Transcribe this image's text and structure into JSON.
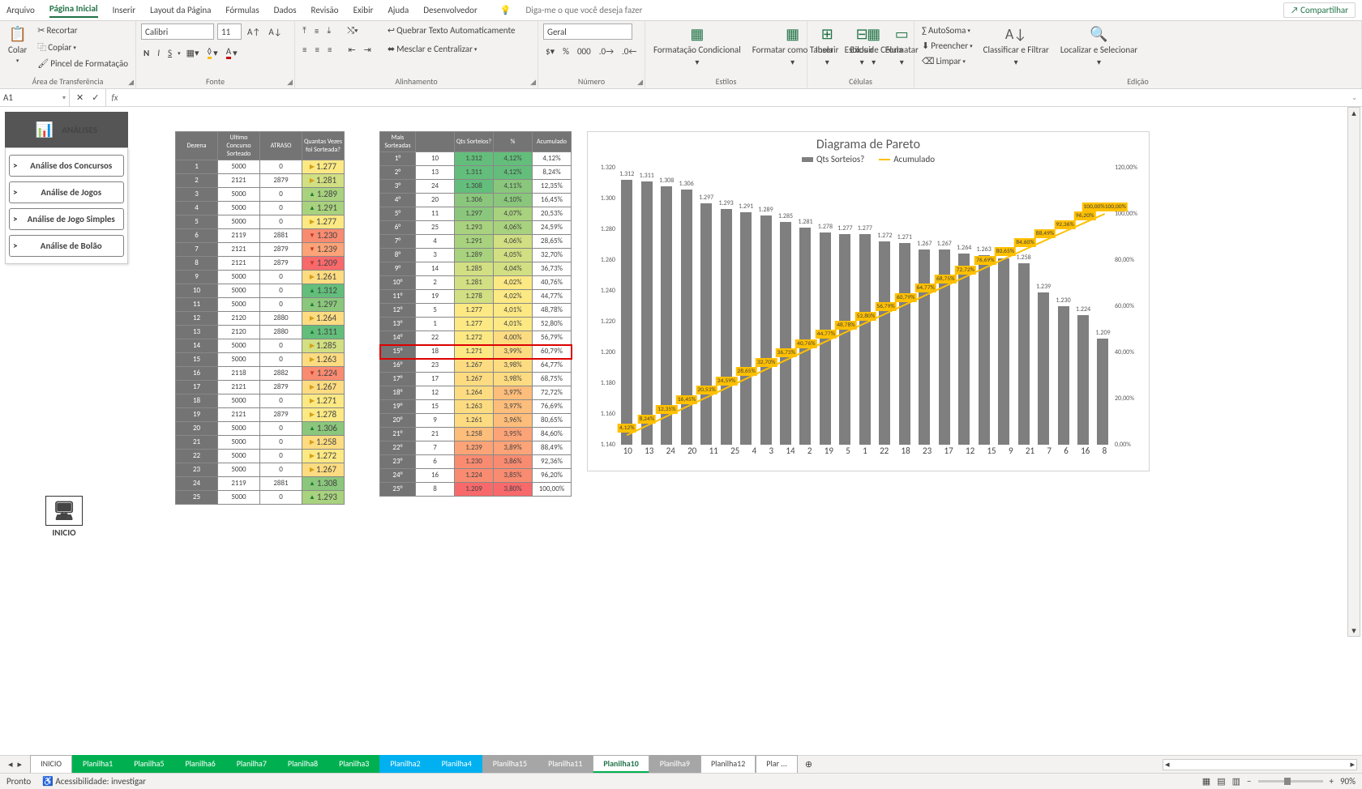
{
  "menubar": {
    "items": [
      "Arquivo",
      "Página Inicial",
      "Inserir",
      "Layout da Página",
      "Fórmulas",
      "Dados",
      "Revisão",
      "Exibir",
      "Ajuda",
      "Desenvolvedor"
    ],
    "active": 1,
    "tellme": "Diga-me o que você deseja fazer",
    "share": "Compartilhar"
  },
  "ribbon": {
    "clipboard": {
      "paste": "Colar",
      "cut": "Recortar",
      "copy": "Copiar",
      "painter": "Pincel de Formatação",
      "label": "Área de Transferência"
    },
    "font": {
      "name": "Calibri",
      "size": "11",
      "label": "Fonte",
      "bold": "N",
      "italic": "I",
      "underline": "S"
    },
    "align": {
      "wrap": "Quebrar Texto Automaticamente",
      "merge": "Mesclar e Centralizar",
      "label": "Alinhamento"
    },
    "number": {
      "format": "Geral",
      "label": "Número"
    },
    "styles": {
      "cond": "Formatação Condicional",
      "table": "Formatar como Tabela",
      "cell": "Estilos de Célula",
      "label": "Estilos"
    },
    "cells": {
      "insert": "Inserir",
      "delete": "Excluir",
      "format": "Formatar",
      "label": "Células"
    },
    "editing": {
      "sum": "AutoSoma",
      "fill": "Preencher",
      "clear": "Limpar",
      "sort": "Classificar e Filtrar",
      "find": "Localizar e Selecionar",
      "label": "Edição"
    }
  },
  "namebox": "A1",
  "sidepanel": {
    "title": "ANÁLISES",
    "buttons": [
      "Análise dos Concursos",
      "Análise de Jogos",
      "Análise de Jogo Simples",
      "Análise de Bolão"
    ],
    "home": "INICIO"
  },
  "table1": {
    "headers": [
      "Dezena",
      "Ultimo Concurso Sorteado",
      "ATRASO",
      "Quantas Vezes foi Sorteada?"
    ],
    "rows": [
      [
        "1",
        "5000",
        "0",
        "1.277",
        "y2",
        "rt"
      ],
      [
        "2",
        "2121",
        "2879",
        "1.281",
        "y1",
        "rt"
      ],
      [
        "3",
        "5000",
        "0",
        "1.289",
        "g3",
        "up"
      ],
      [
        "4",
        "5000",
        "0",
        "1.291",
        "g3",
        "up"
      ],
      [
        "5",
        "5000",
        "0",
        "1.277",
        "y2",
        "rt"
      ],
      [
        "6",
        "2119",
        "2881",
        "1.230",
        "r1",
        "dn"
      ],
      [
        "7",
        "2121",
        "2879",
        "1.239",
        "o2",
        "dn"
      ],
      [
        "8",
        "2121",
        "2879",
        "1.209",
        "r2",
        "dn"
      ],
      [
        "9",
        "5000",
        "0",
        "1.261",
        "y3",
        "rt"
      ],
      [
        "10",
        "5000",
        "0",
        "1.312",
        "g1",
        "up"
      ],
      [
        "11",
        "5000",
        "0",
        "1.297",
        "g2",
        "up"
      ],
      [
        "12",
        "2120",
        "2880",
        "1.264",
        "y3",
        "rt"
      ],
      [
        "13",
        "2120",
        "2880",
        "1.311",
        "g1",
        "up"
      ],
      [
        "14",
        "5000",
        "0",
        "1.285",
        "y1",
        "rt"
      ],
      [
        "15",
        "5000",
        "0",
        "1.263",
        "y3",
        "rt"
      ],
      [
        "16",
        "2118",
        "2882",
        "1.224",
        "r1",
        "dn"
      ],
      [
        "17",
        "2121",
        "2879",
        "1.267",
        "y3",
        "rt"
      ],
      [
        "18",
        "5000",
        "0",
        "1.271",
        "y2",
        "rt"
      ],
      [
        "19",
        "2121",
        "2879",
        "1.278",
        "y2",
        "rt"
      ],
      [
        "20",
        "5000",
        "0",
        "1.306",
        "g2",
        "up"
      ],
      [
        "21",
        "5000",
        "0",
        "1.258",
        "y3",
        "rt"
      ],
      [
        "22",
        "5000",
        "0",
        "1.272",
        "y2",
        "rt"
      ],
      [
        "23",
        "5000",
        "0",
        "1.267",
        "y3",
        "rt"
      ],
      [
        "24",
        "2119",
        "2881",
        "1.308",
        "g2",
        "up"
      ],
      [
        "25",
        "5000",
        "0",
        "1.293",
        "g3",
        "up"
      ]
    ]
  },
  "table2": {
    "headers": [
      "Mais Sorteadas",
      "",
      "Qts Sorteios?",
      "%",
      "Acumulado"
    ],
    "rows": [
      [
        "1°",
        "10",
        "1.312",
        "4,12%",
        "4,12%",
        "g1",
        "g1"
      ],
      [
        "2°",
        "13",
        "1.311",
        "4,12%",
        "8,24%",
        "g1",
        "g1"
      ],
      [
        "3°",
        "24",
        "1.308",
        "4,11%",
        "12,35%",
        "g1",
        "g2"
      ],
      [
        "4°",
        "20",
        "1.306",
        "4,10%",
        "16,45%",
        "g2",
        "g2"
      ],
      [
        "5°",
        "11",
        "1.297",
        "4,07%",
        "20,53%",
        "g2",
        "g3"
      ],
      [
        "6°",
        "25",
        "1.293",
        "4,06%",
        "24,59%",
        "g3",
        "g3"
      ],
      [
        "7°",
        "4",
        "1.291",
        "4,06%",
        "28,65%",
        "g3",
        "y1"
      ],
      [
        "8°",
        "3",
        "1.289",
        "4,05%",
        "32,70%",
        "g3",
        "y1"
      ],
      [
        "9°",
        "14",
        "1.285",
        "4,04%",
        "36,73%",
        "y1",
        "y1"
      ],
      [
        "10°",
        "2",
        "1.281",
        "4,02%",
        "40,76%",
        "y1",
        "y2"
      ],
      [
        "11°",
        "19",
        "1.278",
        "4,02%",
        "44,77%",
        "y1",
        "y2"
      ],
      [
        "12°",
        "5",
        "1.277",
        "4,01%",
        "48,78%",
        "y2",
        "y2"
      ],
      [
        "13°",
        "1",
        "1.277",
        "4,01%",
        "52,80%",
        "y2",
        "y2"
      ],
      [
        "14°",
        "22",
        "1.272",
        "4,00%",
        "56,79%",
        "y2",
        "y3"
      ],
      [
        "15°",
        "18",
        "1.271",
        "3,99%",
        "60,79%",
        "y2",
        "y3"
      ],
      [
        "16°",
        "23",
        "1.267",
        "3,98%",
        "64,77%",
        "y3",
        "y3"
      ],
      [
        "17°",
        "17",
        "1.267",
        "3,98%",
        "68,75%",
        "y3",
        "y3"
      ],
      [
        "18°",
        "12",
        "1.264",
        "3,97%",
        "72,72%",
        "y3",
        "o1"
      ],
      [
        "19°",
        "15",
        "1.263",
        "3,97%",
        "76,69%",
        "y3",
        "o1"
      ],
      [
        "20°",
        "9",
        "1.261",
        "3,96%",
        "80,65%",
        "y3",
        "o1"
      ],
      [
        "21°",
        "21",
        "1.258",
        "3,95%",
        "84,60%",
        "o1",
        "o2"
      ],
      [
        "22°",
        "7",
        "1.239",
        "3,89%",
        "88,49%",
        "o2",
        "o2"
      ],
      [
        "23°",
        "6",
        "1.230",
        "3,86%",
        "92,36%",
        "r1",
        "r1"
      ],
      [
        "24°",
        "16",
        "1.224",
        "3,85%",
        "96,20%",
        "r1",
        "r1"
      ],
      [
        "25°",
        "8",
        "1.209",
        "3,80%",
        "100,00%",
        "r2",
        "r2"
      ]
    ],
    "highlight": 14
  },
  "chart_data": {
    "type": "pareto",
    "title": "Diagrama de Pareto",
    "legend": [
      "Qts Sorteios?",
      "Acumulado"
    ],
    "ylim": [
      1140,
      1320
    ],
    "y2lim": [
      0,
      120
    ],
    "yticks": [
      "1.140",
      "1.160",
      "1.180",
      "1.200",
      "1.220",
      "1.240",
      "1.260",
      "1.280",
      "1.300",
      "1.320"
    ],
    "y2ticks": [
      "0,00%",
      "20,00%",
      "40,00%",
      "60,00%",
      "80,00%",
      "100,00%",
      "120,00%"
    ],
    "categories": [
      "10",
      "13",
      "24",
      "20",
      "11",
      "25",
      "4",
      "3",
      "14",
      "2",
      "19",
      "5",
      "1",
      "22",
      "18",
      "23",
      "17",
      "12",
      "15",
      "9",
      "21",
      "7",
      "6",
      "16",
      "8"
    ],
    "bars": [
      1312,
      1311,
      1308,
      1306,
      1297,
      1293,
      1291,
      1289,
      1285,
      1281,
      1278,
      1277,
      1277,
      1272,
      1271,
      1267,
      1267,
      1264,
      1263,
      1261,
      1258,
      1239,
      1230,
      1224,
      1209
    ],
    "bar_labels": [
      "1.312",
      "1.311",
      "1.308",
      "1.306",
      "1.297",
      "1.293",
      "1.291",
      "1.289",
      "1.285",
      "1.281",
      "1.278",
      "1.277",
      "1.277",
      "1.272",
      "1.271",
      "1.267",
      "1.267",
      "1.264",
      "1.263",
      "1.261",
      "1.258",
      "1.239",
      "1.230",
      "1.224",
      "1.209"
    ],
    "cum": [
      4.12,
      8.24,
      12.35,
      16.45,
      20.53,
      24.59,
      28.65,
      32.7,
      36.73,
      40.76,
      44.77,
      48.78,
      52.8,
      56.79,
      60.79,
      64.77,
      68.75,
      72.72,
      76.69,
      80.65,
      84.6,
      88.49,
      92.36,
      96.2,
      100.0
    ],
    "cum_labels": [
      "4,12%",
      "8,24%",
      "12,35%",
      "16,45%",
      "20,53%",
      "24,59%",
      "28,65%",
      "32,70%",
      "36,73%",
      "40,76%",
      "44,77%",
      "48,78%",
      "52,80%",
      "56,79%",
      "60,79%",
      "64,77%",
      "68,75%",
      "72,72%",
      "76,69%",
      "80,65%",
      "84,60%",
      "88,49%",
      "92,36%",
      "96,20%",
      "100,00%100,00%"
    ]
  },
  "sheets": {
    "tabs": [
      {
        "n": "INICIO",
        "c": ""
      },
      {
        "n": "Planilha1",
        "c": "grn"
      },
      {
        "n": "Planilha5",
        "c": "grn"
      },
      {
        "n": "Planilha6",
        "c": "grn"
      },
      {
        "n": "Planilha7",
        "c": "grn"
      },
      {
        "n": "Planilha8",
        "c": "grn"
      },
      {
        "n": "Planilha3",
        "c": "grn"
      },
      {
        "n": "Planilha2",
        "c": "blu"
      },
      {
        "n": "Planilha4",
        "c": "blu"
      },
      {
        "n": "Planilha15",
        "c": "gry"
      },
      {
        "n": "Planilha11",
        "c": "gry"
      },
      {
        "n": "Planilha10",
        "c": "act"
      },
      {
        "n": "Planilha9",
        "c": "gry"
      },
      {
        "n": "Planilha12",
        "c": ""
      },
      {
        "n": "Plar ...",
        "c": ""
      }
    ]
  },
  "statusbar": {
    "ready": "Pronto",
    "access": "Acessibilidade: investigar",
    "zoom": "90%"
  }
}
